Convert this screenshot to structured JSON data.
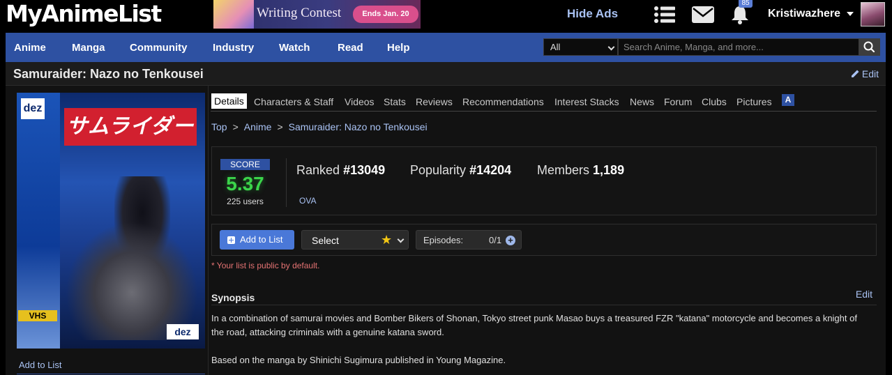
{
  "header": {
    "logo": "MyAnimeList",
    "banner": {
      "title": "Writing Contest",
      "ends": "Ends Jan. 20"
    },
    "hide_ads": "Hide Ads",
    "notification_count": "85",
    "username": "Kristiwazhere"
  },
  "nav": {
    "items": [
      "Anime",
      "Manga",
      "Community",
      "Industry",
      "Watch",
      "Read",
      "Help"
    ],
    "search_category": "All",
    "search_placeholder": "Search Anime, Manga, and more..."
  },
  "page": {
    "title": "Samuraider: Nazo no Tenkousei",
    "edit": "Edit"
  },
  "sidebar": {
    "cover_text": {
      "brand": "dez",
      "title": "サムライダー",
      "format": "VHS"
    },
    "add_to_list": "Add to List"
  },
  "tabs": [
    "Details",
    "Characters & Staff",
    "Videos",
    "Stats",
    "Reviews",
    "Recommendations",
    "Interest Stacks",
    "News",
    "Forum",
    "Clubs",
    "Pictures"
  ],
  "tab_logo": "A",
  "breadcrumb": [
    "Top",
    "Anime",
    "Samuraider: Nazo no Tenkousei"
  ],
  "stats": {
    "score_label": "SCORE",
    "score": "5.37",
    "score_users": "225 users",
    "ranked_label": "Ranked",
    "ranked": "#13049",
    "popularity_label": "Popularity",
    "popularity": "#14204",
    "members_label": "Members",
    "members": "1,189",
    "type": "OVA"
  },
  "list_controls": {
    "add_button": "Add to List",
    "select_label": "Select",
    "episodes_label": "Episodes:",
    "episodes_count": "0/1",
    "public_note": "* Your list is public by default."
  },
  "synopsis": {
    "heading": "Synopsis",
    "edit": "Edit",
    "paragraph1": "In a combination of samurai movies and Bomber Bikers of Shonan, Tokyo street punk Masao buys a treasured FZR \"katana\" motorcycle and becomes a knight of the road, attacking criminals with a genuine katana sword.",
    "paragraph2": "Based on the manga by Shinichi Sugimura published in Young Magazine."
  },
  "colors": {
    "nav_blue": "#2e51a2",
    "link": "#a9c2f3",
    "score_green": "#3bd44a",
    "note_red": "#e57373"
  }
}
